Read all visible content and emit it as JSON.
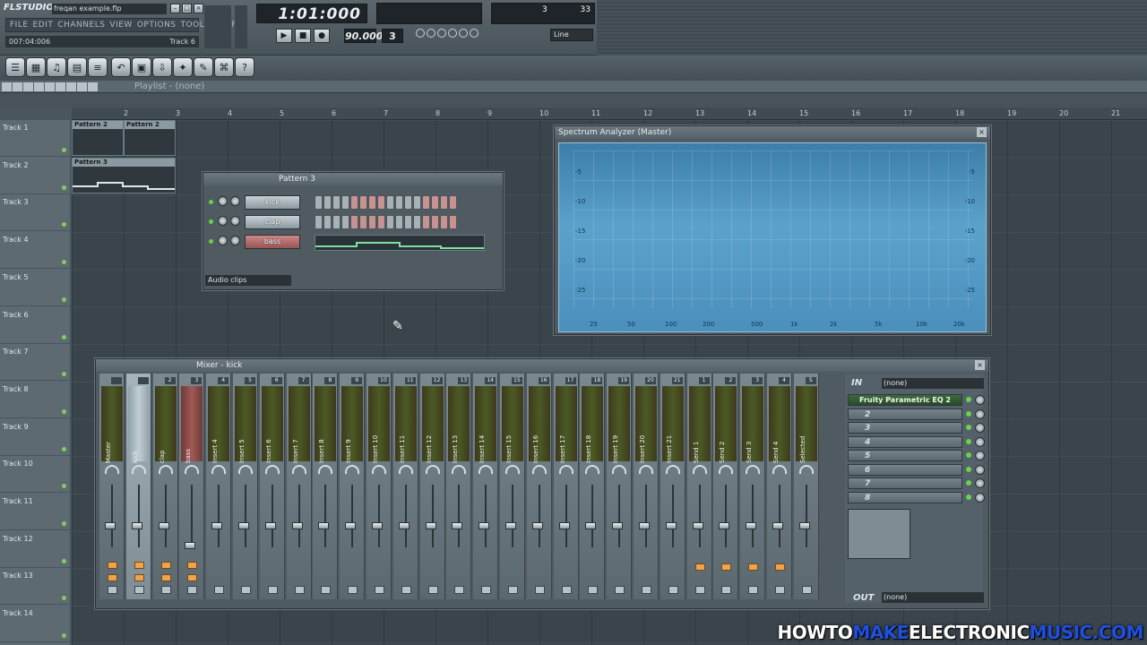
{
  "app": {
    "logo": "FLSTUDIO",
    "filename": "freqan example.flp"
  },
  "menu": [
    "FILE",
    "EDIT",
    "CHANNELS",
    "VIEW",
    "OPTIONS",
    "TOOLS",
    "HELP"
  ],
  "hint": {
    "time": "007:04:006",
    "track": "Track 6"
  },
  "transport": {
    "time": "1:01:000",
    "tempo": "90.000",
    "pattern": "3",
    "snap": "Line",
    "cpu_left": "3",
    "cpu_right": "33"
  },
  "playlist": {
    "title": "Playlist - (none)",
    "ruler": [
      "2",
      "3",
      "4",
      "5",
      "6",
      "7",
      "8",
      "9",
      "10",
      "11",
      "12",
      "13",
      "14",
      "15",
      "16",
      "17",
      "18",
      "19",
      "20",
      "21"
    ],
    "tracks": [
      "Track 1",
      "Track 2",
      "Track 3",
      "Track 4",
      "Track 5",
      "Track 6",
      "Track 7",
      "Track 8",
      "Track 9",
      "Track 10",
      "Track 11",
      "Track 12",
      "Track 13",
      "Track 14"
    ],
    "clips": [
      {
        "label": "Pattern 2"
      },
      {
        "label": "Pattern 2"
      },
      {
        "label": "Pattern 3"
      }
    ]
  },
  "channel_rack": {
    "title": "Pattern 3",
    "channels": [
      "kick",
      "clap",
      "bass"
    ],
    "filter": "Audio clips"
  },
  "spectrum": {
    "title": "Spectrum Analyzer (Master)",
    "freq_labels": [
      "25",
      "50",
      "100",
      "200",
      "500",
      "1k",
      "2k",
      "5k",
      "10k",
      "20k"
    ],
    "db_left": [
      "-5",
      "-10",
      "-15",
      "-20",
      "-25"
    ],
    "db_right": [
      "-5",
      "-10",
      "-15",
      "-20",
      "-25"
    ]
  },
  "mixer": {
    "title": "Mixer - kick",
    "strips": [
      "Master",
      "kick",
      "clap",
      "bass",
      "Insert 4",
      "Insert 5",
      "Insert 6",
      "Insert 7",
      "Insert 8",
      "Insert 9",
      "Insert 10",
      "Insert 11",
      "Insert 12",
      "Insert 13",
      "Insert 14",
      "Insert 15",
      "Insert 16",
      "Insert 17",
      "Insert 18",
      "Insert 19",
      "Insert 20",
      "Insert 21",
      "Send 1",
      "Send 2",
      "Send 3",
      "Send 4",
      "Selected"
    ],
    "numbers": [
      "",
      "",
      "2",
      "3",
      "4",
      "5",
      "6",
      "7",
      "8",
      "9",
      "10",
      "11",
      "12",
      "13",
      "14",
      "15",
      "16",
      "17",
      "18",
      "19",
      "20",
      "21",
      "1",
      "2",
      "3",
      "4",
      "S"
    ],
    "in_label": "IN",
    "in_value": "(none)",
    "out_label": "OUT",
    "out_value": "(none)",
    "fx_slots": [
      "Fruity Parametric EQ 2",
      "2",
      "3",
      "4",
      "5",
      "6",
      "7",
      "8"
    ]
  },
  "watermark": {
    "a": "HOWTO",
    "b": "MAKE",
    "c": "ELECTRONIC",
    "d": "MUSIC.COM"
  }
}
